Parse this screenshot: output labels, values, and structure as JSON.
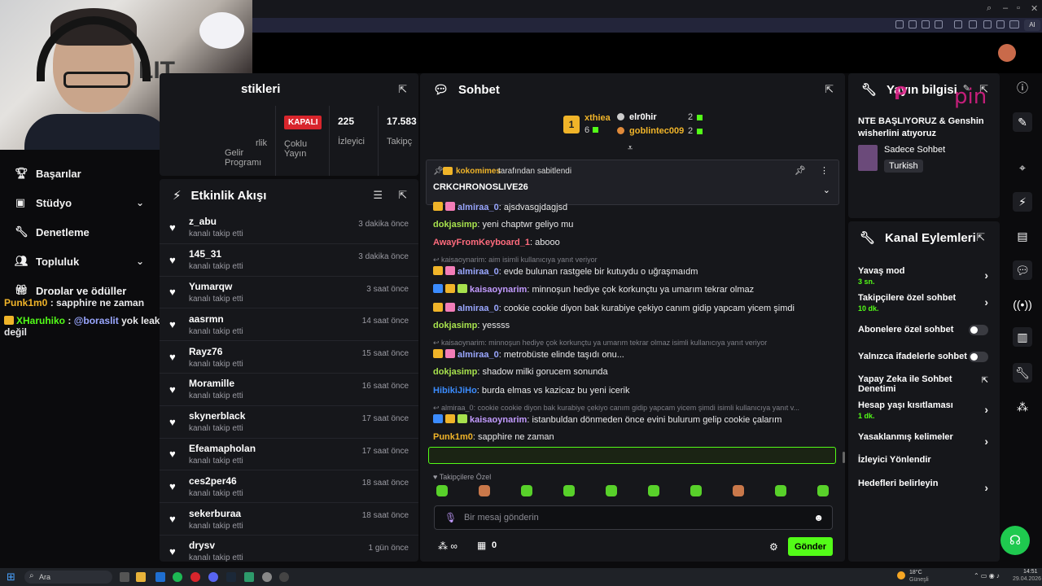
{
  "overlay_logo": "pin",
  "stats": {
    "title_fragment": "stikleri",
    "gelir_label_1": "rlik",
    "gelir_label_2": "Gelir",
    "gelir_label_3": "Programı",
    "multi_badge": "KAPALI",
    "multi_label_1": "Çoklu",
    "multi_label_2": "Yayın",
    "viewers_value": "225",
    "viewers_label": "İzleyici",
    "followers_value": "17.583",
    "followers_label": "Takipç"
  },
  "left_nav": {
    "items": [
      {
        "label": "Başarılar",
        "icon": "trophy-icon"
      },
      {
        "label": "Stüdyo",
        "icon": "studio-icon",
        "expandable": true
      },
      {
        "label": "Denetleme",
        "icon": "wrench-icon"
      },
      {
        "label": "Topluluk",
        "icon": "people-icon",
        "expandable": true
      },
      {
        "label": "Droplar ve ödüller",
        "icon": "gift-icon"
      }
    ]
  },
  "overlay_chat": [
    {
      "user": "Punk1m0",
      "text": " : sapphire ne zaman"
    },
    {
      "user": "XHaruhiko",
      "mention": "@boraslit",
      "text": " yok leak değil"
    }
  ],
  "activity": {
    "title": "Etkinlik Akışı",
    "items": [
      {
        "name": "z_abu",
        "action": "kanalı takip etti",
        "time": "3 dakika önce"
      },
      {
        "name": "145_31",
        "action": "kanalı takip etti",
        "time": "3 dakika önce"
      },
      {
        "name": "Yumarqw",
        "action": "kanalı takip etti",
        "time": "3 saat önce"
      },
      {
        "name": "aasrmn",
        "action": "kanalı takip etti",
        "time": "14 saat önce"
      },
      {
        "name": "Rayz76",
        "action": "kanalı takip etti",
        "time": "15 saat önce"
      },
      {
        "name": "Moramille",
        "action": "kanalı takip etti",
        "time": "16 saat önce"
      },
      {
        "name": "skynerblack",
        "action": "kanalı takip etti",
        "time": "17 saat önce"
      },
      {
        "name": "Efeamapholan",
        "action": "kanalı takip etti",
        "time": "17 saat önce"
      },
      {
        "name": "ces2per46",
        "action": "kanalı takip etti",
        "time": "18 saat önce"
      },
      {
        "name": "sekerburaa",
        "action": "kanalı takip etti",
        "time": "18 saat önce"
      },
      {
        "name": "drysv",
        "action": "kanalı takip etti",
        "time": "1 gün önce"
      }
    ]
  },
  "chat": {
    "title": "Sohbet",
    "leaders": [
      {
        "rank": "1",
        "name": "xthiea",
        "count": "6"
      },
      {
        "name": "elr0hir",
        "count": "2"
      },
      {
        "name": "goblintec009",
        "count": "2"
      }
    ],
    "pinned_by": "kokomimes",
    "pinned_suffix": "tarafından sabitlendi",
    "pinned_text": "CRKCHRONOSLIVE26",
    "messages": [
      {
        "user": "almiraa_0",
        "color": "#9aa7ff",
        "text": ": ajsdvasgjdagjsd"
      },
      {
        "user": "dokjasimp",
        "color": "#a7e14d",
        "text": ": yeni chaptwr geliyo mu"
      },
      {
        "user": "AwayFromKeyboard_1",
        "color": "#ff6b7d",
        "text": ": abooo"
      },
      {
        "reply": "kaisaoynarim: aim isimli kullanıcıya yanıt veriyor"
      },
      {
        "user": "almiraa_0",
        "color": "#9aa7ff",
        "text": ": evde bulunan rastgele bir kutuydu o uğraşmaıdm"
      },
      {
        "user": "kaisaoynarim",
        "color": "#c39bff",
        "text": ": minnoşun hediye çok korkunçtu ya umarım tekrar olmaz"
      },
      {
        "user": "almiraa_0",
        "color": "#9aa7ff",
        "text": ": cookie cookie diyon bak kurabiye çekiyo canım gidip yapcam yicem şimdi"
      },
      {
        "user": "dokjasimp",
        "color": "#a7e14d",
        "text": ": yessss"
      },
      {
        "reply": "kaisaoynarim: minnoşun hediye çok korkunçtu ya umarım tekrar olmaz isimli kullanıcıya yanıt veriyor"
      },
      {
        "user": "almiraa_0",
        "color": "#9aa7ff",
        "text": ": metrobüste elinde taşıdı onu..."
      },
      {
        "user": "dokjasimp",
        "color": "#a7e14d",
        "text": ": shadow milki gorucem sonunda"
      },
      {
        "user": "HibikiJiHo",
        "color": "#3b8cff",
        "text": ": burda elmas vs kazicaz bu yeni icerik"
      },
      {
        "reply": "almiraa_0: cookie cookie diyon bak kurabiye çekiyo canım gidip yapcam yicem şimdi isimli kullanıcıya yanıt v..."
      },
      {
        "user": "kaisaoynarim",
        "color": "#c39bff",
        "text": ": istanbuldan dönmeden önce evini bulurum gelip cookie çalarım"
      },
      {
        "user": "Punk1m0",
        "color": "#f0b429",
        "text": ": sapphire ne zaman"
      },
      {
        "user": "XHaruhiko",
        "color": "#53fc18",
        "text": ": @boraslit yok leak değil"
      }
    ],
    "followers_only_label": "Takipçilere Özel",
    "input_placeholder": "Bir mesaj gönderin",
    "points": "0",
    "send_label": "Gönder"
  },
  "stream_info": {
    "title": "Yayın bilgisi",
    "stream_title": "NTE BAŞLIYORUZ & Genshin wisherlini atıyoruz",
    "category": "Sadece Sohbet",
    "language": "Turkish"
  },
  "channel_actions": {
    "title": "Kanal Eylemleri",
    "items": [
      {
        "label": "Yavaş mod",
        "sub": "3 sn.",
        "control": "chevron"
      },
      {
        "label": "Takipçilere özel sohbet",
        "sub": "10 dk.",
        "control": "chevron"
      },
      {
        "label": "Abonelere özel sohbet",
        "control": "toggle"
      },
      {
        "label": "Yalnızca ifadelerle sohbet",
        "control": "toggle"
      },
      {
        "label": "Yapay Zeka ile Sohbet Denetimi",
        "control": "external"
      },
      {
        "label": "Hesap yaşı kısıtlaması",
        "sub": "1 dk.",
        "control": "chevron"
      },
      {
        "label": "Yasaklanmış kelimeler",
        "control": "chevron"
      },
      {
        "label": "İzleyici Yönlendir",
        "control": "none"
      },
      {
        "label": "Hedefleri belirleyin",
        "control": "chevron"
      }
    ]
  },
  "taskbar": {
    "search_label": "Ara",
    "weather_temp": "18°C",
    "weather_desc": "Güneşli",
    "time": "14:51",
    "date": "29.04.2026"
  },
  "colors": {
    "accent": "#53fc18",
    "panel": "#16171b",
    "background": "#0b0b0d"
  }
}
